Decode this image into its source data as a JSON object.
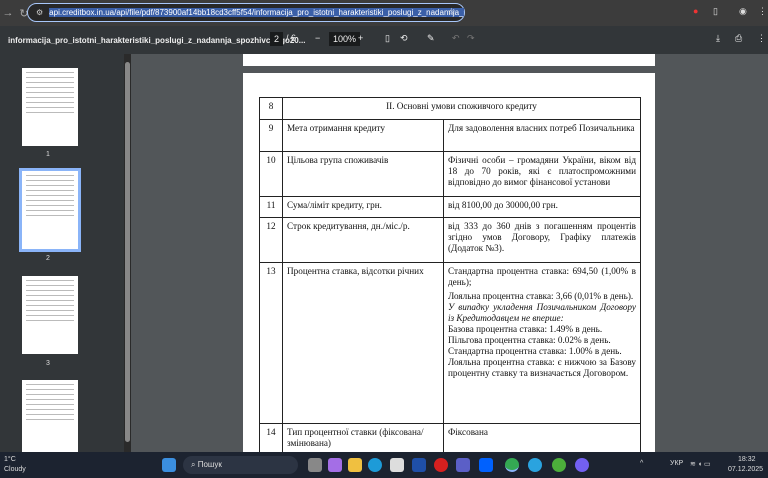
{
  "browser": {
    "url": "api.creditbox.in.ua/api/file/pdf/873900af14bb18cd3cff5f54/informacija_pro_istotni_harakteristiki_poslugi_z_nadannja_spozhivchogo20241120.pdf"
  },
  "pdf": {
    "title": "informacija_pro_istotni_harakteristiki_poslugi_z_nadannja_spozhivchogo20...",
    "page": "2",
    "total": "/ 6",
    "zoom": "100%"
  },
  "thumbnails": [
    "1",
    "2",
    "3"
  ],
  "table": [
    {
      "n": "8",
      "header": "II. Основні умови споживчого кредиту"
    },
    {
      "n": "9",
      "label": "Мета отримання кредиту",
      "value": [
        "Для задоволення власних потреб Позичальника"
      ]
    },
    {
      "n": "10",
      "label": "Цільова група споживачів",
      "value": [
        "Фізичні особи – громадяни України, віком від 18 до 70 років, які є платоспроможними відповідно до вимог фінансової установи"
      ]
    },
    {
      "n": "11",
      "label": "Сума/ліміт кредиту, грн.",
      "value": [
        "від 8100,00 до 30000,00 грн."
      ]
    },
    {
      "n": "12",
      "label": "Строк кредитування, дн./міс./р.",
      "value": [
        "від 333 до 360 днів з погашенням процентів згідно умов Договору, Графіку платежів (Додаток №3)."
      ]
    },
    {
      "n": "13",
      "label": "Процентна ставка, відсотки річних",
      "value": [
        "Стандартна процентна ставка: 694,50 (1,00% в день);",
        "Лояльна процентна ставка: 3,66 (0,01% в день).",
        "У випадку укладення Позичальником Договору із Кредитодавцем не вперше:",
        "Базова процентна ставка: 1.49% в день.",
        "Пільгова процентна ставка: 0.02% в день.",
        "Стандартна процентна ставка: 1.00% в день.",
        "Лояльна процентна ставка: є нижчою за Базову процентну ставку та визначається Договором."
      ]
    },
    {
      "n": "14",
      "label": "Тип процентної ставки (фіксована/змінювана)",
      "value": [
        "Фіксована"
      ]
    }
  ],
  "taskbar": {
    "temp": "1°C",
    "weather": "Cloudy",
    "search": "Пошук",
    "lang": "УКР",
    "time": "18:32",
    "date": "07.12.2025"
  }
}
